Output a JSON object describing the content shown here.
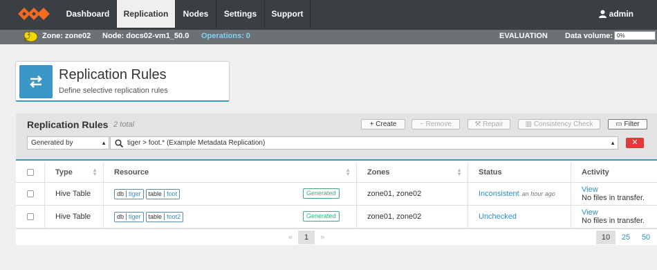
{
  "nav": {
    "tabs": [
      "Dashboard",
      "Replication",
      "Nodes",
      "Settings",
      "Support"
    ],
    "active_tab": "Replication",
    "user": "admin"
  },
  "subbar": {
    "zone": "Zone: zone02",
    "node": "Node: docs02-vm1_50.0",
    "operations": "Operations: 0",
    "license": "EVALUATION",
    "data_volume_label": "Data volume:",
    "data_volume_value": "0%"
  },
  "header": {
    "title": "Replication Rules",
    "subtitle": "Define selective replication rules"
  },
  "panel": {
    "title": "Replication Rules",
    "total": "2 total",
    "buttons": {
      "create": "+ Create",
      "remove": "− Remove",
      "repair": "Repair",
      "consistency": "Consistency Check",
      "filter": "Filter"
    },
    "filter_select": "Generated by",
    "filter_query": "tiger > foot.* (Example Metadata Replication)",
    "clear": "✕"
  },
  "table": {
    "columns": [
      "Type",
      "Resource",
      "Zones",
      "Status",
      "Activity"
    ],
    "rows": [
      {
        "type": "Hive Table",
        "db_key": "db",
        "db_val": "tiger",
        "table_key": "table",
        "table_val": "foot",
        "badge": "Generated",
        "zones": "zone01, zone02",
        "status": "Inconsistent",
        "status_time": "an hour ago",
        "activity_link": "View",
        "activity_text": "No files in transfer."
      },
      {
        "type": "Hive Table",
        "db_key": "db",
        "db_val": "tiger",
        "table_key": "table",
        "table_val": "foot2",
        "badge": "Generated",
        "zones": "zone01, zone02",
        "status": "Unchecked",
        "status_time": "",
        "activity_link": "View",
        "activity_text": "No files in transfer."
      }
    ]
  },
  "pager": {
    "prev": "«",
    "current": "1",
    "next": "»",
    "sizes": [
      "10",
      "25",
      "50"
    ],
    "active_size": "10"
  },
  "colors": {
    "nav_bg": "#3a3f44",
    "accent": "#3797bf",
    "link": "#2e8fc8",
    "generated": "#3cab7c",
    "danger": "#e03a3a"
  }
}
